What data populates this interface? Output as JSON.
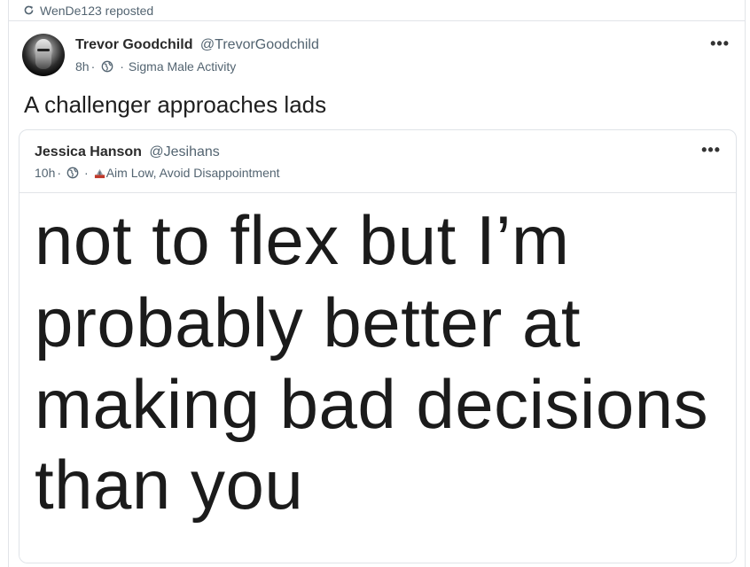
{
  "repost": {
    "text": "WenDe123 reposted",
    "icon": "repost-icon"
  },
  "post": {
    "author_name": "Trevor Goodchild",
    "author_handle": "@TrevorGoodchild",
    "time": "8h",
    "separator": "·",
    "community": "Sigma Male Activity",
    "text": "A challenger approaches lads",
    "more_label": "•••"
  },
  "quoted": {
    "author_name": "Jessica Hanson",
    "author_handle": "@Jesihans",
    "time": "10h",
    "separator": "·",
    "community": "Aim Low, Avoid Disappointment",
    "more_label": "•••",
    "image_text": {
      "line1": "not to flex but I’m",
      "line2": "probably better at",
      "line3": "making bad decisions",
      "line4": "than you"
    }
  },
  "colors": {
    "muted": "#536471",
    "border": "#e1e4e8",
    "text": "#0f1419"
  }
}
